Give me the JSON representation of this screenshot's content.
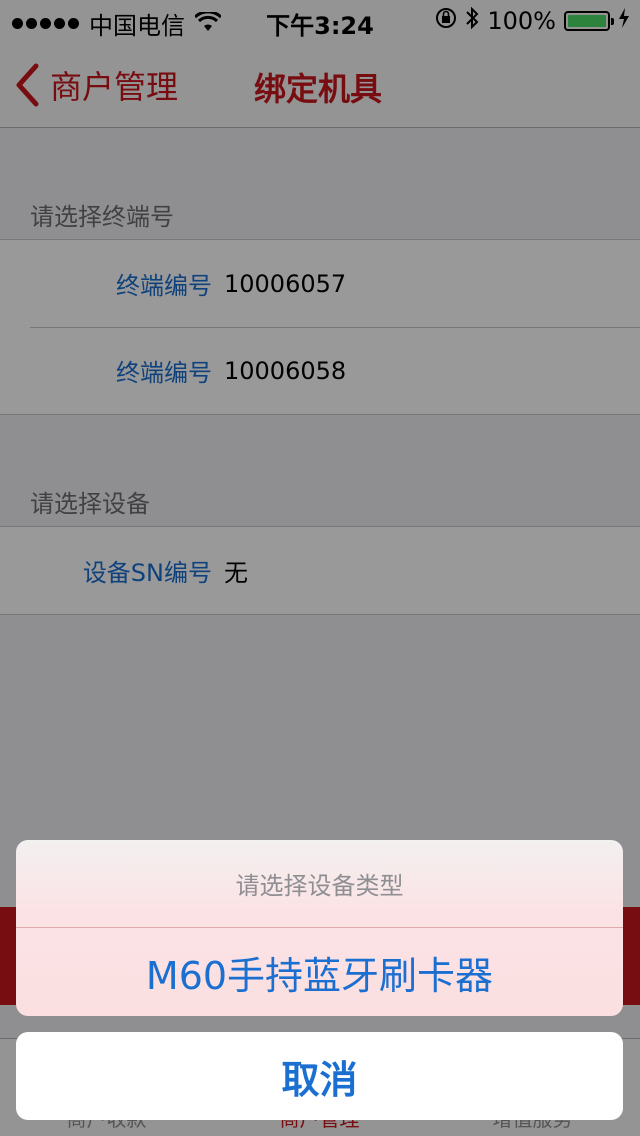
{
  "status_bar": {
    "carrier": "中国电信",
    "time": "下午3:24",
    "battery": "100%",
    "battery_level": 1.0,
    "icons": [
      "signal-dots-icon",
      "wifi-icon",
      "orientation-lock-icon",
      "bluetooth-icon",
      "battery-icon",
      "charging-icon"
    ]
  },
  "nav": {
    "back_label": "商户管理",
    "title": "绑定机具"
  },
  "terminal_section": {
    "header": "请选择终端号",
    "rows": [
      {
        "label": "终端编号",
        "value": "10006057"
      },
      {
        "label": "终端编号",
        "value": "10006058"
      }
    ]
  },
  "device_section": {
    "header": "请选择设备",
    "rows": [
      {
        "label": "设备SN编号",
        "value": "无"
      }
    ]
  },
  "tab_bar": {
    "tabs": [
      {
        "label": "商户收款"
      },
      {
        "label": "商户管理"
      },
      {
        "label": "增值服务"
      }
    ]
  },
  "action_sheet": {
    "title": "请选择设备类型",
    "option": "M60手持蓝牙刷卡器",
    "cancel": "取消"
  },
  "colors": {
    "accent": "#c8161d",
    "link_blue": "#1a6fd1",
    "battery_green": "#4cd964"
  }
}
